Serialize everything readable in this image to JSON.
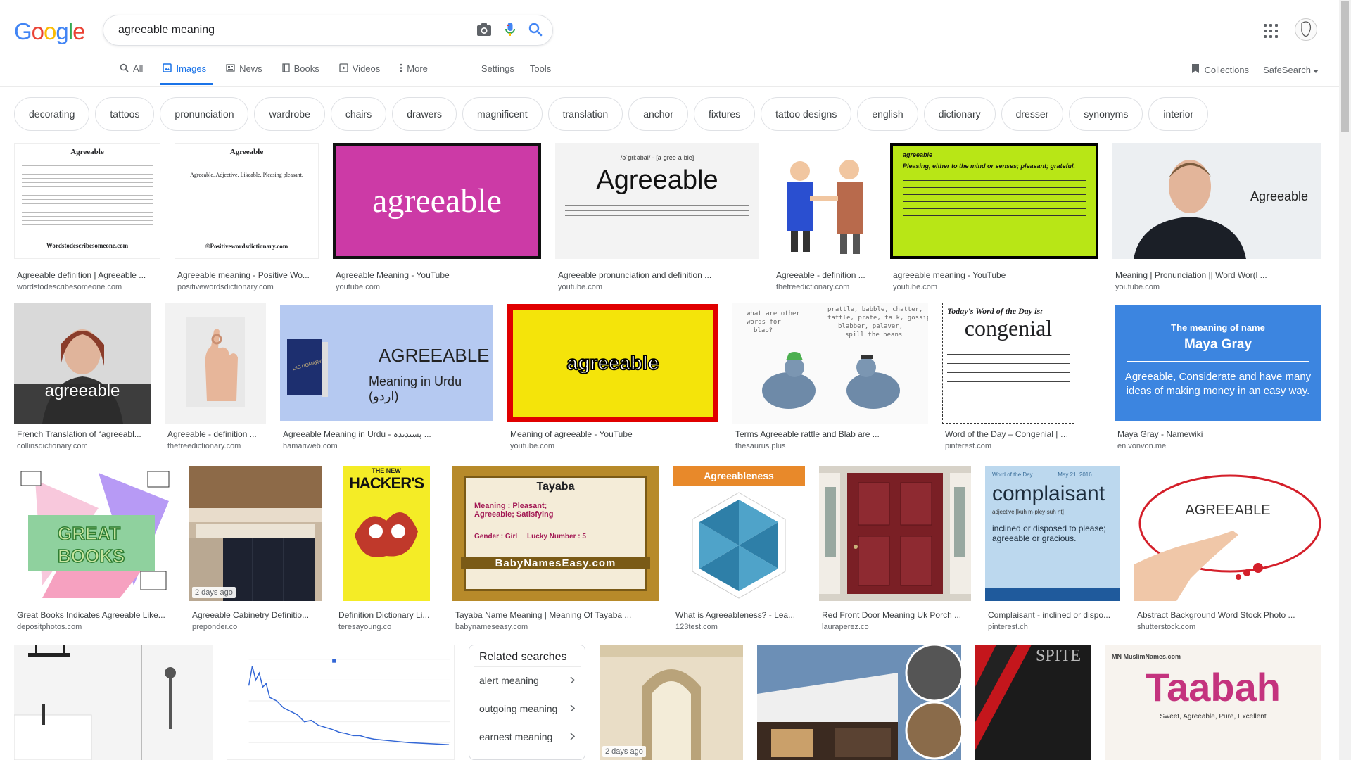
{
  "logo": {
    "letters": [
      "G",
      "o",
      "o",
      "g",
      "l",
      "e"
    ],
    "colors": [
      "#4285f4",
      "#ea4335",
      "#fbbc05",
      "#4285f4",
      "#34a853",
      "#ea4335"
    ]
  },
  "search": {
    "query": "agreeable meaning"
  },
  "nav": {
    "tabs": [
      {
        "label": "All",
        "icon": "search-icon"
      },
      {
        "label": "Images",
        "icon": "image-icon",
        "active": true
      },
      {
        "label": "News",
        "icon": "news-icon"
      },
      {
        "label": "Books",
        "icon": "book-icon"
      },
      {
        "label": "Videos",
        "icon": "video-icon"
      },
      {
        "label": "More",
        "icon": "more-vert-icon"
      }
    ],
    "settings": "Settings",
    "tools": "Tools",
    "collections": "Collections",
    "safesearch": "SafeSearch"
  },
  "chips": [
    "decorating",
    "tattoos",
    "pronunciation",
    "wardrobe",
    "chairs",
    "drawers",
    "magnificent",
    "translation",
    "anchor",
    "fixtures",
    "tattoo designs",
    "english",
    "dictionary",
    "dresser",
    "synonyms",
    "interior"
  ],
  "results_row1": [
    {
      "caption": "Agreeable definition | Agreeable ...",
      "source": "wordstodescribesomeone.com",
      "thumb_title": "Agreeable",
      "thumb_sub": "Wordstodescribesomeone.com"
    },
    {
      "caption": "Agreeable meaning - Positive Wo...",
      "source": "positivewordsdictionary.com",
      "thumb_title": "Agreeable",
      "thumb_text": "Agreeable. Adjective. Likeable. Pleasing pleasant.",
      "thumb_sub": "©Positivewordsdictionary.com"
    },
    {
      "caption": "Agreeable Meaning - YouTube",
      "source": "youtube.com",
      "thumb_word": "agreeable"
    },
    {
      "caption": "Agreeable pronunciation and definition ...",
      "source": "youtube.com",
      "thumb_word": "Agreeable",
      "thumb_phon": "/əˈɡriːəbal/ - [a·gree·a·ble]"
    },
    {
      "caption": "Agreeable - definition ...",
      "source": "thefreedictionary.com"
    },
    {
      "caption": "agreeable meaning - YouTube",
      "source": "youtube.com",
      "thumb_head": "agreeable",
      "thumb_text": "Pleasing, either to the mind or senses; pleasant; grateful."
    },
    {
      "caption": "Meaning | Pronunciation || Word Wor(l ...",
      "source": "youtube.com",
      "thumb_word": "Agreeable"
    }
  ],
  "results_row2": [
    {
      "caption": "French Translation of “agreeabl...",
      "source": "collinsdictionary.com",
      "thumb_word": "agreeable"
    },
    {
      "caption": "Agreeable - definition ...",
      "source": "thefreedictionary.com"
    },
    {
      "caption": "Agreeable Meaning in Urdu - پسندیدہ ...",
      "source": "hamariweb.com",
      "thumb_word": "AGREEABLE",
      "thumb_sub": "Meaning in Urdu (اردو)"
    },
    {
      "caption": "Meaning of agreeable - YouTube",
      "source": "youtube.com",
      "thumb_word": "agreeable"
    },
    {
      "caption": "Terms Agreeable rattle and Blab are ...",
      "source": "thesaurus.plus"
    },
    {
      "caption": "Word of the Day – Congenial | Words...",
      "source": "pinterest.com",
      "thumb_word": "congenial",
      "thumb_head": "Today's Word of the Day is:"
    },
    {
      "caption": "Maya Gray - Namewiki",
      "source": "en.vonvon.me",
      "thumb_head": "The meaning of name",
      "thumb_word": "Maya Gray",
      "thumb_text": "Agreeable, Considerate and have many ideas of making money in an easy way."
    }
  ],
  "results_row3": [
    {
      "caption": "Great Books Indicates Agreeable Like...",
      "source": "depositphotos.com",
      "thumb_word": "GREAT BOOKS"
    },
    {
      "caption": "Agreeable Cabinetry Definitio...",
      "source": "preponder.co",
      "badge": "2 days ago"
    },
    {
      "caption": "Definition Dictionary Li...",
      "source": "teresayoung.co",
      "thumb_word": "HACKER'S"
    },
    {
      "caption": "Tayaba Name Meaning | Meaning Of Tayaba ...",
      "source": "babynameseasy.com",
      "thumb_word": "Tayaba",
      "thumb_text": "Meaning : Pleasant; Agreeable; Satisfying",
      "thumb_sub": "BabyNamesEasy.com"
    },
    {
      "caption": "What is Agreeableness? - Lea...",
      "source": "123test.com",
      "thumb_word": "Agreeableness"
    },
    {
      "caption": "Red Front Door Meaning Uk Porch ...",
      "source": "lauraperez.co"
    },
    {
      "caption": "Complaisant - inclined or dispo...",
      "source": "pinterest.ch",
      "thumb_word": "complaisant",
      "thumb_text": "inclined or disposed to please; agreeable or gracious."
    },
    {
      "caption": "Abstract Background Word Stock Photo ...",
      "source": "shutterstock.com",
      "thumb_word": "AGREEABLE"
    }
  ],
  "results_row4": [
    {
      "name": "bathroom"
    },
    {
      "name": "ngram-chart"
    },
    {
      "name": "interior",
      "badge": "2 days ago"
    },
    {
      "name": "house"
    },
    {
      "name": "spite",
      "thumb_word": "SPITE"
    },
    {
      "name": "taabah",
      "thumb_word": "Taabah",
      "thumb_text": "Sweet, Agreeable, Pure, Excellent"
    }
  ],
  "related": {
    "title": "Related searches",
    "items": [
      "alert meaning",
      "outgoing meaning",
      "earnest meaning"
    ]
  }
}
